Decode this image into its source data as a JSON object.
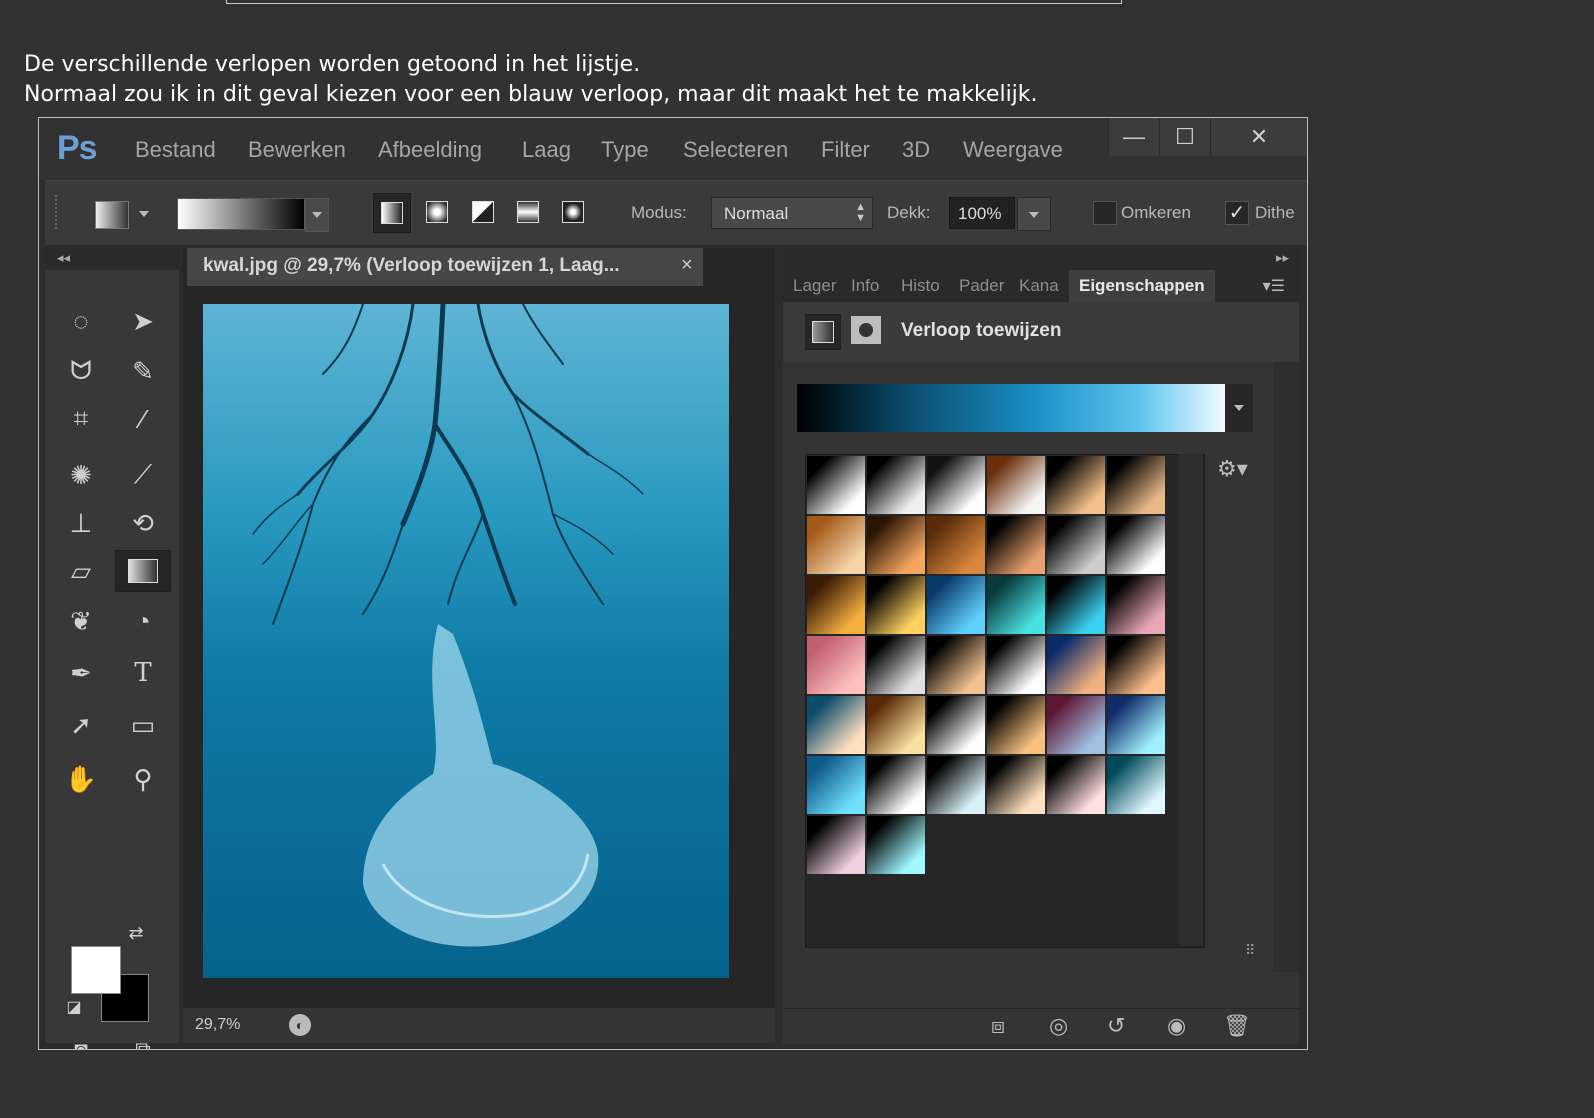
{
  "caption": {
    "line1": "De verschillende verlopen worden getoond in het lijstje.",
    "line2": "Normaal zou ik in dit geval kiezen voor een blauw verloop, maar dit maakt het te makkelijk."
  },
  "app": {
    "logo": "Ps",
    "menu": [
      "Bestand",
      "Bewerken",
      "Afbeelding",
      "Laag",
      "Type",
      "Selecteren",
      "Filter",
      "3D",
      "Weergave"
    ],
    "window_buttons": {
      "minimize": "—",
      "maximize": "☐",
      "close": "✕"
    }
  },
  "options": {
    "mode_label": "Modus:",
    "mode_value": "Normaal",
    "opacity_label": "Dekk:",
    "opacity_value": "100%",
    "reverse_label": "Omkeren",
    "dither_label": "Dithe"
  },
  "document": {
    "tab_title": "kwal.jpg @ 29,7% (Verloop toewijzen 1, Laag...",
    "tab_close": "×",
    "zoom": "29,7%"
  },
  "panel": {
    "tabs": [
      "Lager",
      "Info",
      "Histo",
      "Pader",
      "Kana",
      "Eigenschappen"
    ],
    "active_tab": "Eigenschappen",
    "properties_title": "Verloop toewijzen"
  },
  "colors": {
    "foreground": "#ffffff",
    "background": "#000000",
    "accent": "#6aa0d6"
  }
}
